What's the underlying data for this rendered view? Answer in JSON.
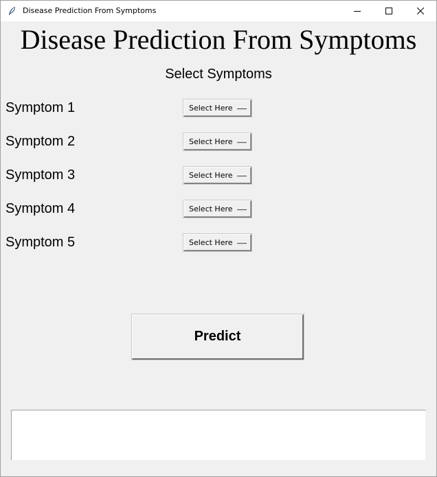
{
  "window": {
    "title": "Disease Prediction From Symptoms",
    "icon": "feather-icon"
  },
  "header": {
    "title": "Disease Prediction From Symptoms",
    "subtitle": "Select Symptoms"
  },
  "symptoms": [
    {
      "label": "Symptom 1",
      "value": "Select Here"
    },
    {
      "label": "Symptom 2",
      "value": "Select Here"
    },
    {
      "label": "Symptom 3",
      "value": "Select Here"
    },
    {
      "label": "Symptom 4",
      "value": "Select Here"
    },
    {
      "label": "Symptom 5",
      "value": "Select Here"
    }
  ],
  "predict": {
    "label": "Predict"
  },
  "result": {
    "text": ""
  }
}
